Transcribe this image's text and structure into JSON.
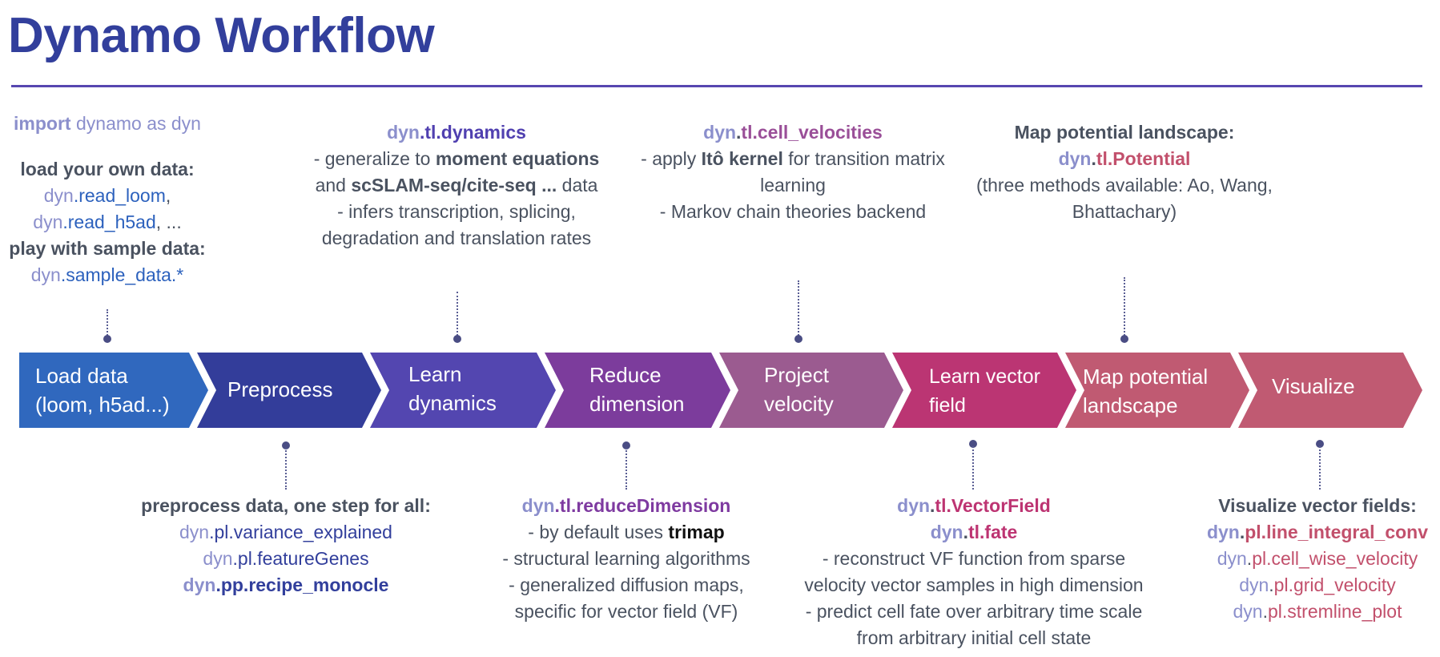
{
  "title": "Dynamo Workflow",
  "colors": {
    "title": "#323f9c",
    "rule": "#5747b0",
    "connector": "#4a4d84"
  },
  "steps": [
    {
      "id": "load",
      "lines": [
        "Load data",
        "(loom, h5ad...)"
      ],
      "color": "#3068be"
    },
    {
      "id": "preprocess",
      "lines": [
        "Preprocess"
      ],
      "color": "#333d9a"
    },
    {
      "id": "learn-dynamics",
      "lines": [
        "Learn",
        "dynamics"
      ],
      "color": "#5346b0"
    },
    {
      "id": "reduce-dimension",
      "lines": [
        "Reduce",
        "dimension"
      ],
      "color": "#7c3c9c"
    },
    {
      "id": "project-velocity",
      "lines": [
        "Project",
        "velocity"
      ],
      "color": "#9b5b90"
    },
    {
      "id": "learn-vector-field",
      "lines": [
        "Learn vector",
        "field"
      ],
      "color": "#bb3573"
    },
    {
      "id": "map-potential",
      "lines": [
        "Map potential",
        "landscape"
      ],
      "color": "#c05a72"
    },
    {
      "id": "visualize",
      "lines": [
        "Visualize"
      ],
      "color": "#c05a72"
    }
  ],
  "notes": {
    "load": {
      "import_kw": "import",
      "import_rest": " dynamo as dyn",
      "own_data_heading": "load your own data:",
      "read_loom_prefix": "dyn",
      "read_loom_fn": ".read_loom",
      "read_loom_suffix": ",",
      "read_h5ad_prefix": "dyn",
      "read_h5ad_fn": ".read_h5ad",
      "read_h5ad_suffix": ", ...",
      "sample_heading": "play with sample data:",
      "sample_prefix": "dyn",
      "sample_fn": ".sample_data.*"
    },
    "preprocess": {
      "heading": "preprocess data, one step for all:",
      "fn1_prefix": "dyn",
      "fn1": ".pl.variance_explained",
      "fn2_prefix": "dyn",
      "fn2": ".pl.featureGenes",
      "fn3_prefix": "dyn",
      "fn3": ".pp.recipe_monocle"
    },
    "dynamics": {
      "fn_prefix": "dyn",
      "fn": ".tl.dynamics",
      "l1a": "- generalize to ",
      "l1b": "moment equations",
      "l2a": "and ",
      "l2b": "scSLAM-seq/cite-seq ...",
      "l2c": " data",
      "l3": "- infers transcription, splicing,",
      "l4": "degradation and translation rates"
    },
    "reduce": {
      "fn_prefix": "dyn",
      "fn": ".tl.reduceDimension",
      "l1a": "- by default uses ",
      "l1b": "trimap",
      "l2": "- structural learning algorithms",
      "l3": "- generalized diffusion maps,",
      "l4": "specific for vector field (VF)"
    },
    "velocity": {
      "fn_prefix": "dyn",
      "fn_dot": ".",
      "fn": "tl.cell_velocities",
      "l1a": "- apply ",
      "l1b": "Itô kernel",
      "l1c": " for transition matrix",
      "l2": "learning",
      "l3": "- Markov chain theories backend"
    },
    "vector_field": {
      "fn1_prefix": "dyn",
      "fn1_dot": ".",
      "fn1": "tl.VectorField",
      "fn2_prefix": "dyn",
      "fn2_dot": ".",
      "fn2": "tl.fate",
      "l1": "- reconstruct VF function from sparse",
      "l2": "velocity vector samples in high dimension",
      "l3": "- predict cell fate over arbitrary time scale",
      "l4": "from arbitrary initial cell state"
    },
    "potential": {
      "heading": "Map potential landscape:",
      "fn_prefix": "dyn",
      "fn_dot": ".",
      "fn": "tl.Potential",
      "l1": "(three methods available: Ao, Wang,",
      "l2": "Bhattachary)"
    },
    "visualize": {
      "heading": "Visualize vector fields:",
      "fn1_prefix": "dyn",
      "fn1_dot": ".",
      "fn1": "pl.line_integral_conv",
      "fn2_prefix": "dyn",
      "fn2_dot": ".",
      "fn2": "pl.cell_wise_velocity",
      "fn3_prefix": "dyn",
      "fn3_dot": ".",
      "fn3": "pl.grid_velocity",
      "fn4_prefix": "dyn",
      "fn4_dot": ".",
      "fn4": "pl.stremline_plot"
    }
  }
}
